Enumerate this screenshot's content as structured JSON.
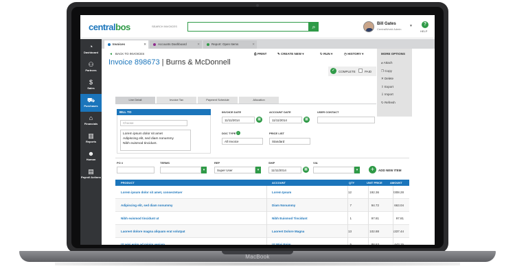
{
  "device": {
    "brand_label": "MacBook"
  },
  "app": {
    "logo_part1": "central",
    "logo_part2": "bos",
    "search_label": "SEARCH INVOICES",
    "search_value": "",
    "user_name": "Bill Gates",
    "user_role": "CentralWorld Admin",
    "help_label": "HELP"
  },
  "sidebar": {
    "items": [
      {
        "label": "Dashboard",
        "icon": "dashboard-icon"
      },
      {
        "label": "Partners",
        "icon": "partners-icon"
      },
      {
        "label": "Sales",
        "icon": "dollar-icon"
      },
      {
        "label": "Purchases",
        "icon": "cart-icon"
      },
      {
        "label": "Financials",
        "icon": "bank-icon"
      },
      {
        "label": "Reports",
        "icon": "bar-chart-icon"
      },
      {
        "label": "Human",
        "icon": "person-icon"
      },
      {
        "label": "Payroll Actions",
        "icon": "payroll-icon"
      }
    ]
  },
  "tabs": [
    {
      "label": "Invoices",
      "dot": "#1b75bb"
    },
    {
      "label": "Accounts Dashboard",
      "dot": "#8e2d8e"
    },
    {
      "label": "Report: Open Items",
      "dot": "#2f9a47"
    }
  ],
  "header": {
    "back_label": "BACK TO INVOICES",
    "title_invoice": "Invoice 898673",
    "title_rest": " | Burns & McDonnell",
    "print": "PRINT",
    "create_new": "CREATE NEW",
    "run": "RUN",
    "history": "HISTORY",
    "more_options": "MORE OPTIONS",
    "complete": "COMPLETE",
    "paid": "PAID"
  },
  "more_menu": [
    "Attach",
    "Copy",
    "Delete",
    "Export",
    "Import",
    "Refresh"
  ],
  "subtabs": [
    "Line Detail",
    "Invoice Tax",
    "Payment Schedule",
    "Allocation"
  ],
  "billto": {
    "heading": "BILL TO",
    "placeholder": "Choose",
    "address": [
      "Lorem ipsum dolor sit amet",
      "Adipiscing elit, sed diam nonummy",
      "Nibh euismod tincidunt."
    ]
  },
  "fields": {
    "invoice_date_label": "INVOICE DATE",
    "invoice_date": "11/11/2014",
    "account_date_label": "ACCOUNT DATE",
    "account_date": "11/11/2014",
    "user_contact_label": "USER CONTACT",
    "doc_type_label": "DOC TYPE",
    "doc_type": "All Invoice",
    "price_list_label": "PRICE LIST",
    "price_list": "Standard",
    "po_label": "PO #",
    "terms_label": "TERMS",
    "rep_label": "REP",
    "rep_value": "Super User",
    "ship_label": "SHIP",
    "ship_value": "11/11/2014",
    "via_label": "VIA",
    "add_item": "ADD NEW ITEM"
  },
  "table": {
    "headers": [
      "PRODUCT",
      "ACCOUNT",
      "QTY",
      "UNIT PRICE",
      "AMOUNT"
    ],
    "rows": [
      {
        "product": "Lorem ipsum dolor sit amet, consectetuer",
        "account": "Lorem Ipsum",
        "qty": "12",
        "unit": "192.36",
        "amount": "2308.28"
      },
      {
        "product": "Adipiscing elit, sed diam nonummy",
        "account": "Diam Nonummy",
        "qty": "7",
        "unit": "94.72",
        "amount": "663.04"
      },
      {
        "product": "Nibh euismod tincidunt ut",
        "account": "Nibh Euismod Tincidunt",
        "qty": "1",
        "unit": "97.81",
        "amount": "97.81"
      },
      {
        "product": "Laoreet dolore magna aliquam erat volutpat",
        "account": "Laoreet Dolore Magna",
        "qty": "13",
        "unit": "102.88",
        "amount": "1337.44"
      },
      {
        "product": "Ut wisi enim ad minim veniam",
        "account": "Ut Wisi Enim",
        "qty": "5",
        "unit": "88.63",
        "amount": "443.15"
      }
    ]
  }
}
